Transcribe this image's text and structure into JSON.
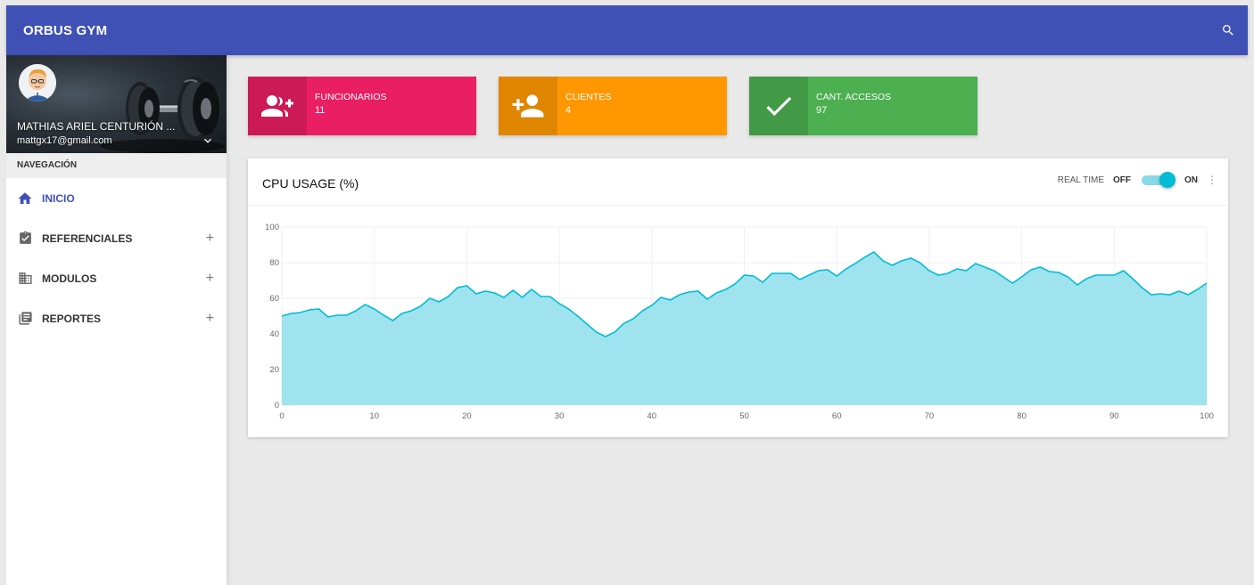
{
  "app": {
    "title": "ORBUS GYM"
  },
  "user": {
    "name": "MATHIAS ARIEL CENTURIÓN ...",
    "email": "mattgx17@gmail.com"
  },
  "nav": {
    "header": "NAVEGACIÓN",
    "items": [
      {
        "label": "INICIO",
        "icon": "home-icon",
        "expandable": false,
        "active": true
      },
      {
        "label": "REFERENCIALES",
        "icon": "assignment-check-icon",
        "expandable": true,
        "active": false
      },
      {
        "label": "MODULOS",
        "icon": "building-icon",
        "expandable": true,
        "active": false
      },
      {
        "label": "REPORTES",
        "icon": "report-icon",
        "expandable": true,
        "active": false
      }
    ],
    "expand_glyph": "+"
  },
  "info_boxes": [
    {
      "title": "FUNCIONARIOS",
      "value": "11",
      "color": "#e91e63",
      "icon": "group-add-icon"
    },
    {
      "title": "CLIENTES",
      "value": "4",
      "color": "#ff9800",
      "icon": "person-add-icon"
    },
    {
      "title": "CANT. ACCESOS",
      "value": "97",
      "color": "#4caf50",
      "icon": "check-icon"
    }
  ],
  "cpu_card": {
    "title": "CPU USAGE (%)",
    "realtime_label": "REAL TIME",
    "off_label": "OFF",
    "on_label": "ON",
    "realtime_on": true
  },
  "colors": {
    "primary": "#3f51b5",
    "accent": "#00bcd4",
    "area_fill": "#9ee3ee"
  },
  "chart_data": {
    "type": "area",
    "title": "",
    "xlabel": "",
    "ylabel": "",
    "xlim": [
      0,
      100
    ],
    "ylim": [
      0,
      100
    ],
    "xticks": [
      0,
      10,
      20,
      30,
      40,
      50,
      60,
      70,
      80,
      90,
      100
    ],
    "yticks": [
      0,
      20,
      40,
      60,
      80,
      100
    ],
    "grid": true,
    "series": [
      {
        "values": [
          50,
          51.5,
          52,
          53.5,
          54,
          49.5,
          50.5,
          50.5,
          53,
          56.5,
          54,
          50.5,
          47.5,
          51.5,
          53,
          55.5,
          60,
          58,
          61,
          66,
          67,
          62.5,
          64,
          63,
          60.5,
          64.5,
          60.5,
          65,
          61,
          61,
          57,
          54,
          50,
          45.5,
          41,
          38.5,
          41,
          46,
          48.5,
          53,
          56,
          60.5,
          59,
          62,
          63.5,
          64,
          59.5,
          63,
          65,
          68,
          73,
          72.5,
          69,
          74,
          74,
          74,
          70.5,
          73,
          75.5,
          76,
          72.5,
          76.5,
          79.5,
          83,
          86,
          81,
          78.5,
          81,
          82.5,
          80,
          75.5,
          73,
          74,
          76.5,
          75.5,
          79.5,
          77.5,
          75.5,
          72,
          68.5,
          72,
          76,
          77.5,
          75,
          74.5,
          72,
          67.5,
          71,
          73,
          73,
          73,
          75.5,
          71,
          66,
          62,
          62.5,
          62,
          64,
          62,
          65,
          68.5
        ]
      }
    ]
  }
}
